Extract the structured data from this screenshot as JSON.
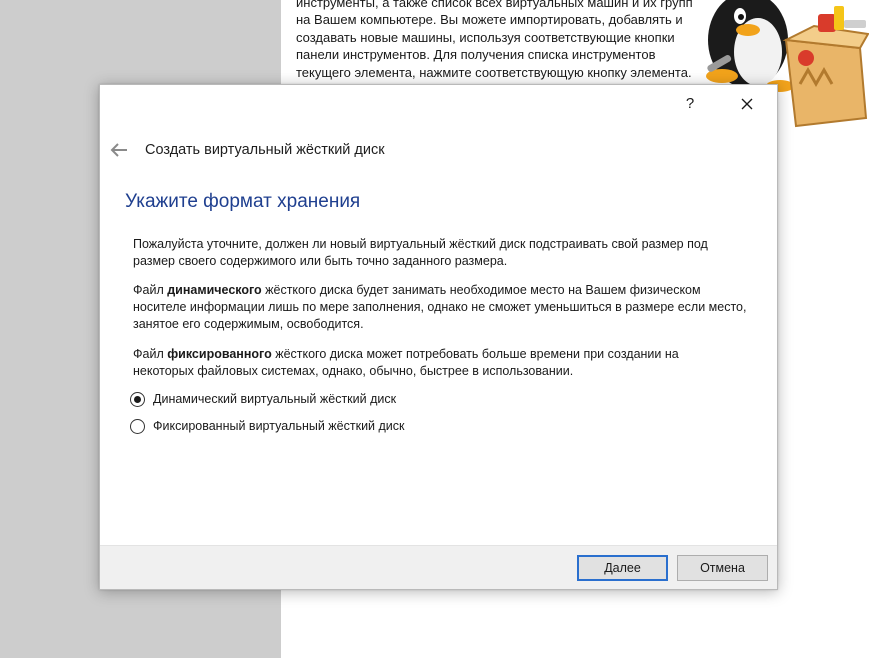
{
  "background": {
    "welcome_lines": [
      "инструменты, а также список всех виртуальных машин и их групп",
      "на Вашем компьютере. Вы можете импортировать, добавлять и",
      "создавать новые машины, используя соответствующие кнопки",
      "панели инструментов. Для получения списка инструментов",
      "текущего элемента, нажмите соответствующую кнопку элемента."
    ]
  },
  "dialog": {
    "help_label": "?",
    "wizard_title": "Создать виртуальный жёсткий диск",
    "heading": "Укажите формат хранения",
    "para1": [
      "Пожалуйста уточните, должен ли новый виртуальный жёсткий диск подстраивать свой размер под",
      "размер своего содержимого или быть точно заданного размера."
    ],
    "para2": {
      "prefix": "Файл ",
      "bold": "динамического",
      "rest": " жёсткого диска будет занимать необходимое место на Вашем физическом",
      "lines": [
        "носителе информации лишь по мере заполнения, однако не сможет уменьшиться в размере если место,",
        "занятое его содержимым, освободится."
      ]
    },
    "para3": {
      "prefix": "Файл ",
      "bold": "фиксированного",
      "rest": " жёсткого диска может потребовать больше времени при создании на",
      "lines": [
        "некоторых файловых системах, однако, обычно, быстрее в использовании."
      ]
    },
    "options": [
      {
        "label": "Динамический виртуальный жёсткий диск",
        "checked": true
      },
      {
        "label": "Фиксированный виртуальный жёсткий диск",
        "checked": false
      }
    ],
    "next_label": "Далее",
    "cancel_label": "Отмена"
  },
  "colors": {
    "heading": "#1f3f8f",
    "next_border": "#2a6fce",
    "left_pane": "#cdcdcd"
  }
}
